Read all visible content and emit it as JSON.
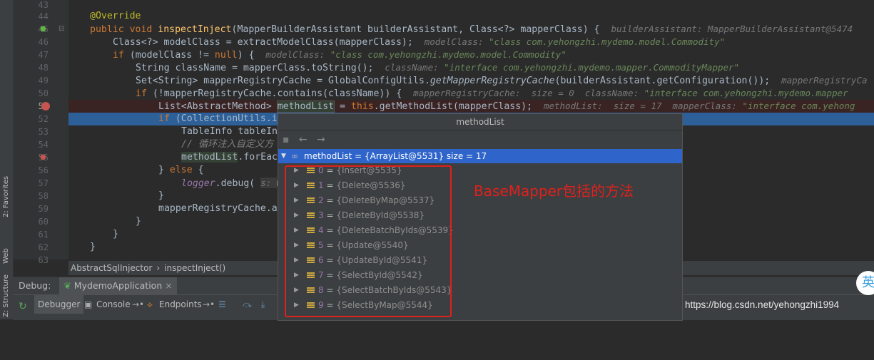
{
  "side_tabs": {
    "favorites": "2: Favorites",
    "web": "Web",
    "structure": "Z: Structure"
  },
  "code": {
    "lines": [
      {
        "no": "43"
      },
      {
        "no": "44"
      },
      {
        "no": "45"
      },
      {
        "no": "46"
      },
      {
        "no": "47"
      },
      {
        "no": "48"
      },
      {
        "no": "49"
      },
      {
        "no": "50"
      },
      {
        "no": "51"
      },
      {
        "no": "52"
      },
      {
        "no": "53"
      },
      {
        "no": "54"
      },
      {
        "no": "55"
      },
      {
        "no": "56"
      },
      {
        "no": "57"
      },
      {
        "no": "58"
      },
      {
        "no": "59"
      },
      {
        "no": "60"
      },
      {
        "no": "61"
      },
      {
        "no": "62"
      },
      {
        "no": "63"
      }
    ],
    "l44": "@Override",
    "l45": {
      "a": "public void ",
      "b": "inspectInject",
      "c": "(MapperBuilderAssistant builderAssistant, Class<?> mapperClass) {",
      "hint": "builderAssistant: MapperBuilderAssistant@5474"
    },
    "l46": {
      "a": "Class<?> modelClass = extractModelClass(mapperClass);",
      "hint": "modelClass: ",
      "hintv": "\"class com.yehongzhi.mydemo.model.Commodity\""
    },
    "l47": {
      "a": "if ",
      "b": "(modelClass != ",
      "c": "null",
      "d": ") {",
      "hint": "modelClass: ",
      "hintv": "\"class com.yehongzhi.mydemo.model.Commodity\""
    },
    "l48": {
      "a": "String className = mapperClass.toString();",
      "hint": "className: ",
      "hintv": "\"interface com.yehongzhi.mydemo.mapper.CommodityMapper\""
    },
    "l49": {
      "a": "Set<String> mapperRegistryCache = GlobalConfigUtils.",
      "b": "getMapperRegistryCache",
      "c": "(builderAssistant.getConfiguration());",
      "hint": "mapperRegistryCa"
    },
    "l50": {
      "a": "if ",
      "b": "(!mapperRegistryCache.contains(className)) {",
      "hint": "mapperRegistryCache:  size = 0  className: ",
      "hintv": "\"interface com.yehongzhi.mydemo.mapper"
    },
    "l51": {
      "a": "List<AbstractMethod> ",
      "b": "methodList",
      "c": " = ",
      "d": "this",
      "e": ".getMethodList(mapperClass);",
      "hint": "methodList:  size = 17  mapperClass: ",
      "hintv": "\"interface com.yehong"
    },
    "l52": {
      "a": "if ",
      "b": "(CollectionUtils.i"
    },
    "l53": "TableInfo tableIn",
    "l54": "// 循环注入自定义方",
    "l55": {
      "a": "methodList",
      "b": ".forEac"
    },
    "l56": {
      "a": "} ",
      "b": "else ",
      "c": "{"
    },
    "l57": {
      "a": "logger",
      "b": ".debug( ",
      "c": "s: ",
      "d": "m"
    },
    "l58": "}",
    "l59": "mapperRegistryCache.a",
    "l60": "}",
    "l61": "}",
    "l62": "}"
  },
  "breadcrumb": {
    "class": "AbstractSqlInjector",
    "sep": "›",
    "method": "inspectInject()"
  },
  "debug": {
    "label": "Debug:",
    "config": "MydemoApplication"
  },
  "toolbar": {
    "debugger": "Debugger",
    "console": "Console",
    "endpoints": "Endpoints"
  },
  "popup": {
    "title": "methodList",
    "root": {
      "name": "methodList",
      "value": " = {ArrayList@5531}  size = 17"
    },
    "items": [
      {
        "index": "0",
        "value": "{Insert@5535}"
      },
      {
        "index": "1",
        "value": "{Delete@5536}"
      },
      {
        "index": "2",
        "value": "{DeleteByMap@5537}"
      },
      {
        "index": "3",
        "value": "{DeleteById@5538}"
      },
      {
        "index": "4",
        "value": "{DeleteBatchByIds@5539}"
      },
      {
        "index": "5",
        "value": "{Update@5540}"
      },
      {
        "index": "6",
        "value": "{UpdateById@5541}"
      },
      {
        "index": "7",
        "value": "{SelectById@5542}"
      },
      {
        "index": "8",
        "value": "{SelectBatchByIds@5543}"
      },
      {
        "index": "9",
        "value": "{SelectByMap@5544}"
      }
    ]
  },
  "annotation": "BaseMapper包括的方法",
  "watermark": "https://blog.csdn.net/yehongzhi1994",
  "ime": "英",
  "colors": {
    "accent": "#2f65ca",
    "annotation_red": "#e0201c",
    "breakpoint": "#c75450"
  }
}
